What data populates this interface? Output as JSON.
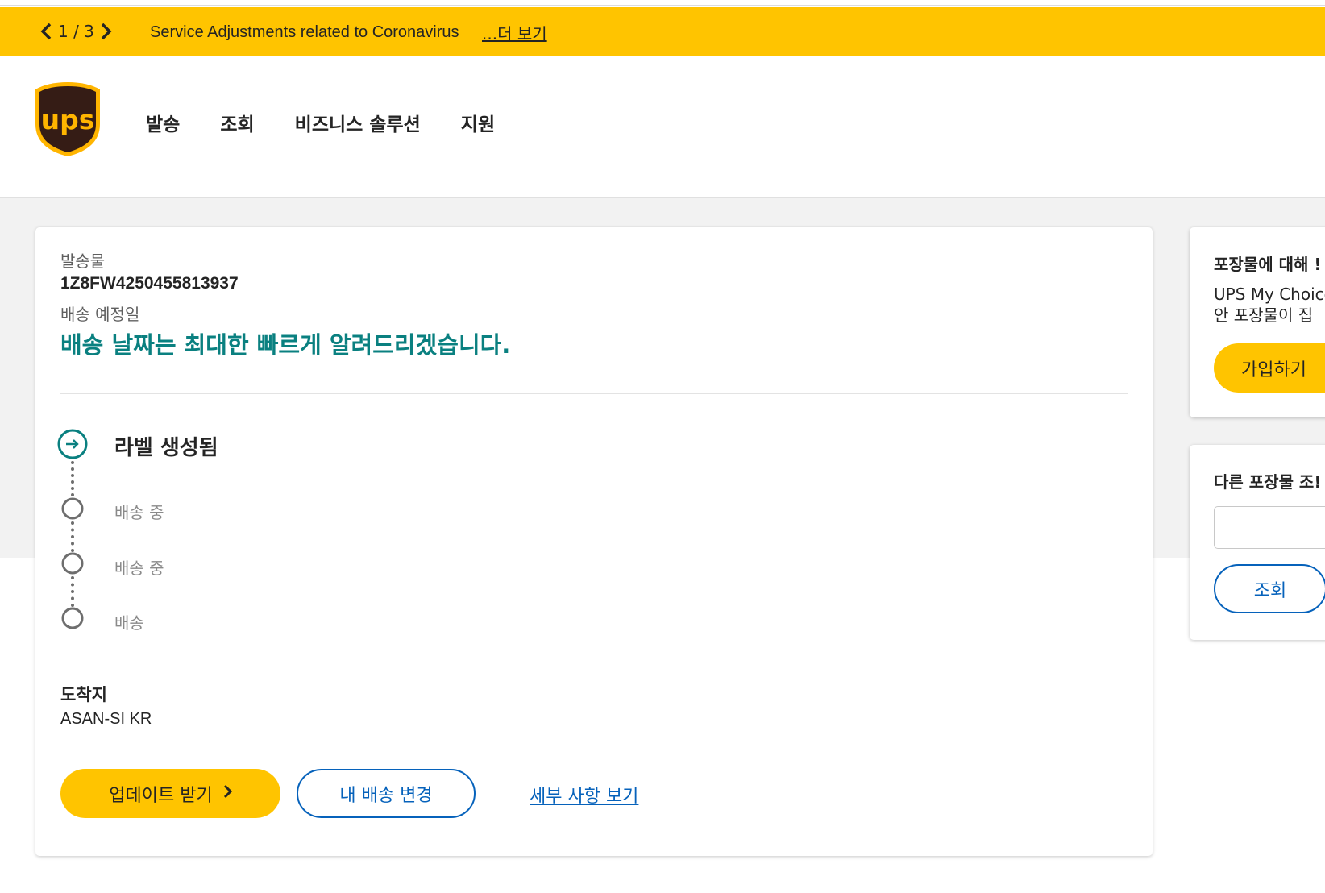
{
  "alert": {
    "page_indicator": "1 / 3",
    "message": "Service Adjustments related to Coronavirus",
    "more_link": "...더 보기"
  },
  "header": {
    "logo_text": "ups",
    "nav": [
      "발송",
      "조회",
      "비즈니스 솔루션",
      "지원"
    ]
  },
  "shipment": {
    "label": "발송물",
    "tracking_number": "1Z8FW4250455813937",
    "delivery_label": "배송 예정일",
    "delivery_message": "배송 날짜는 최대한 빠르게 알려드리겠습니다.",
    "steps": [
      {
        "label": "라벨 생성됨",
        "state": "active"
      },
      {
        "label": "배송 중",
        "state": "pending"
      },
      {
        "label": "배송 중",
        "state": "pending"
      },
      {
        "label": "배송",
        "state": "pending"
      }
    ],
    "destination_label": "도착지",
    "destination_value": "ASAN-SI KR",
    "updates_button": "업데이트 받기",
    "change_button": "내 배송 변경",
    "details_link": "세부 사항 보기"
  },
  "sidebar": {
    "mychoice": {
      "title": "포장물에 대해 !",
      "line1": "UPS My Choice",
      "line2": "안 포장물이 집",
      "button": "가입하기"
    },
    "track_other": {
      "title": "다른 포장물 조!",
      "button": "조회"
    }
  },
  "colors": {
    "brand_yellow": "#ffc400",
    "brand_brown": "#351c15",
    "teal": "#0a8080",
    "link_blue": "#0662bb"
  }
}
